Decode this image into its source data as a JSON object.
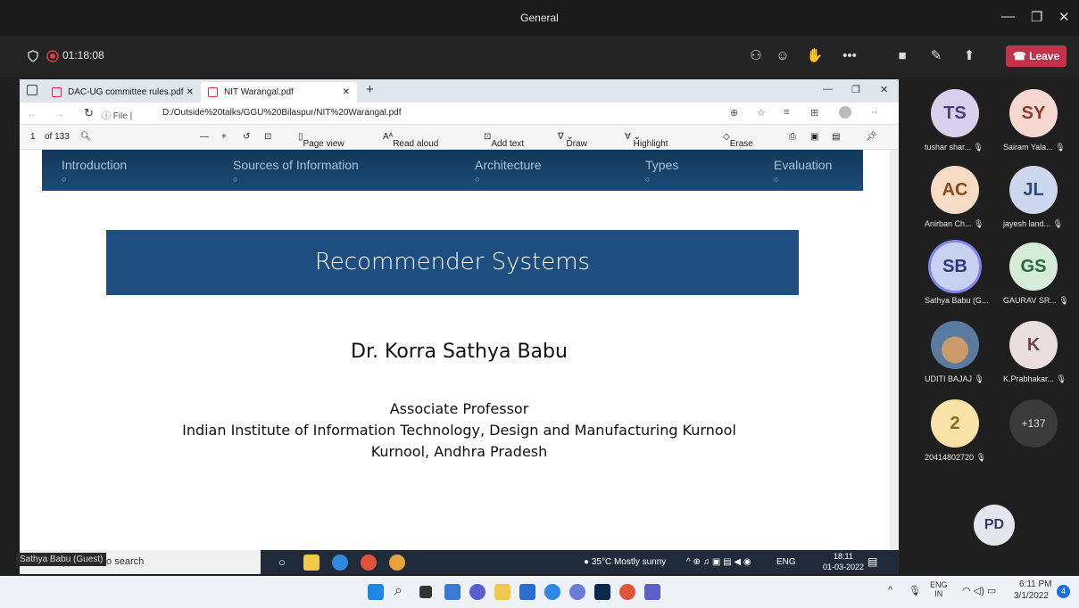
{
  "teams": {
    "title": "General",
    "timer": "01:18:08",
    "leave_label": "Leave"
  },
  "browser": {
    "tabs": [
      {
        "label": "DAC-UG committee rules.pdf"
      },
      {
        "label": "NIT Warangal.pdf"
      }
    ],
    "file_label": "File",
    "url": "D:/Outside%20talks/GGU%20Bilaspur/NIT%20Warangal.pdf",
    "pdf_toolbar": {
      "page": "1",
      "page_count": "of 133",
      "page_view": "Page view",
      "read_aloud": "Read aloud",
      "add_text": "Add text",
      "draw": "Draw",
      "highlight": "Highlight",
      "erase": "Erase"
    }
  },
  "slide": {
    "nav": [
      "Introduction",
      "Sources of Information",
      "Architecture",
      "Types",
      "Evaluation"
    ],
    "title": "Recommender Systems",
    "author": "Dr. Korra Sathya Babu",
    "position": "Associate Professor",
    "institute": "Indian Institute of Information Technology, Design and Manufacturing Kurnool",
    "location": "Kurnool, Andhra Pradesh"
  },
  "shared_taskbar": {
    "search_placeholder": "Type here to search",
    "weather": "35°C  Mostly sunny",
    "lang": "ENG",
    "time": "18:11",
    "date": "01-03-2022"
  },
  "guest_tag": "Sathya Babu (Guest)",
  "participants": [
    {
      "initials": "TS",
      "name": "tushar shar...",
      "color": "#d9d0ee"
    },
    {
      "initials": "SY",
      "name": "Sairam Yala...",
      "color": "#f6d8d0"
    },
    {
      "initials": "AC",
      "name": "Anirban Ch...",
      "color": "#f6dcc4"
    },
    {
      "initials": "JL",
      "name": "jayesh land...",
      "color": "#cdd8ee"
    },
    {
      "initials": "SB",
      "name": "Sathya Babu (G...",
      "color": "#c8d2f0"
    },
    {
      "initials": "GS",
      "name": "GAURAV SR...",
      "color": "#d4ecd8"
    },
    {
      "initials": "",
      "name": "UDITI BAJAJ",
      "color": "#7a8aa0"
    },
    {
      "initials": "K",
      "name": "K.Prabhakar...",
      "color": "#eadede"
    },
    {
      "initials": "2",
      "name": "20414802720",
      "color": "#f8e2a8"
    },
    {
      "initials": "+137",
      "name": "",
      "color": "#3a3a3a"
    },
    {
      "initials": "PD",
      "name": "",
      "color": "#e4e6ee"
    }
  ],
  "win_taskbar": {
    "lang": "ENG",
    "lang_sub": "IN",
    "time": "6:11 PM",
    "date": "3/1/2022",
    "notifications": "4"
  },
  "colors": {
    "leave": "#c4314b",
    "slide_title_bg": "#1e4d80",
    "nav_bg": "#123759"
  }
}
